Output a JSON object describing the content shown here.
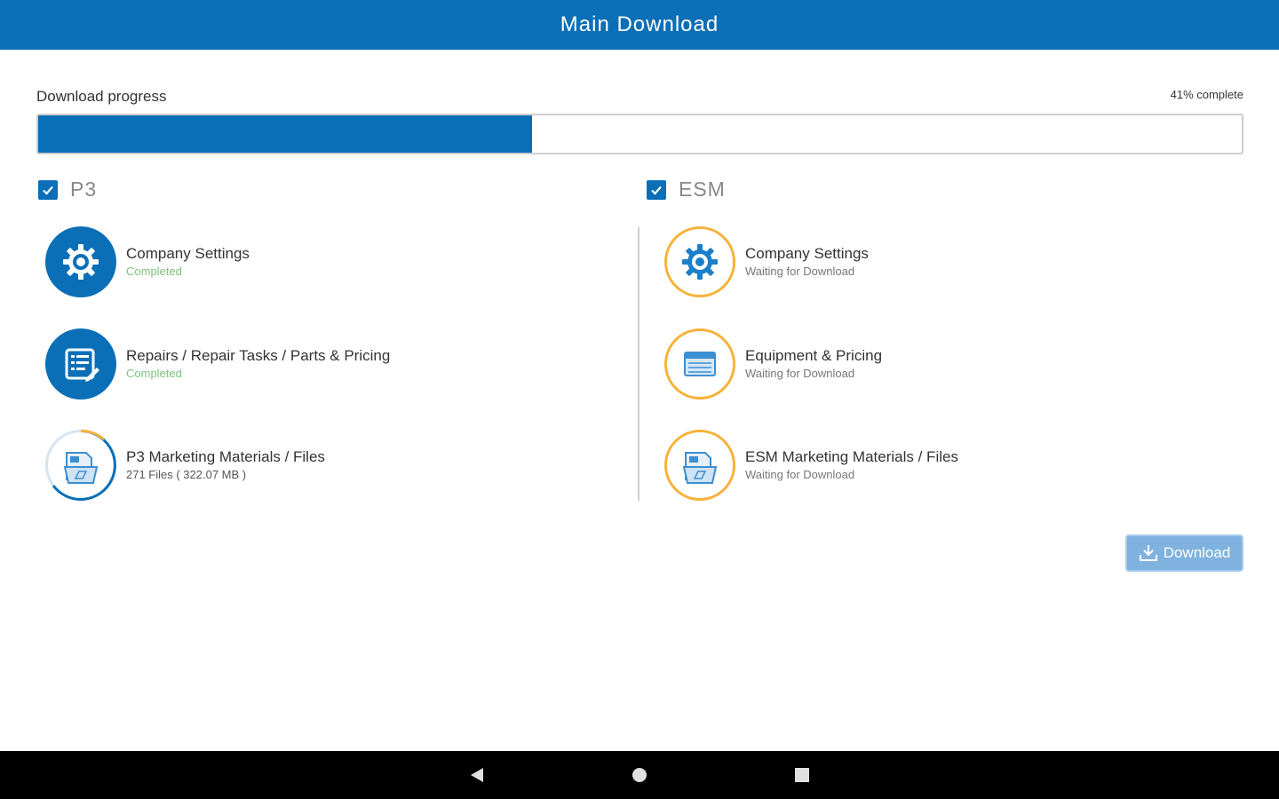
{
  "header": {
    "title": "Main Download"
  },
  "progress": {
    "label": "Download progress",
    "percent_text": "41% complete",
    "fraction": 0.41
  },
  "sections": [
    {
      "title": "P3",
      "checked": true,
      "items": [
        {
          "title": "Company Settings",
          "status": "Completed",
          "icon": "gear-icon"
        },
        {
          "title": "Repairs / Repair Tasks / Parts & Pricing",
          "status": "Completed",
          "icon": "document-edit-icon"
        },
        {
          "title": "P3 Marketing Materials / Files",
          "status": "271 Files ( 322.07 MB )",
          "icon": "files-folder-icon"
        }
      ]
    },
    {
      "title": "ESM",
      "checked": true,
      "items": [
        {
          "title": "Company Settings",
          "status": "Waiting for Download",
          "icon": "gear-icon"
        },
        {
          "title": "Equipment & Pricing",
          "status": "Waiting for Download",
          "icon": "equipment-icon"
        },
        {
          "title": "ESM Marketing Materials / Files",
          "status": "Waiting for Download",
          "icon": "files-folder-icon"
        }
      ]
    }
  ],
  "actions": {
    "download_label": "Download"
  },
  "colors": {
    "primary": "#0a6fb7",
    "completed": "#7dc27d",
    "waiting_ring": "#f7b23b",
    "button": "#7fb2de"
  },
  "nav": {
    "back": "back-icon",
    "home": "home-icon",
    "recents": "recents-icon"
  }
}
